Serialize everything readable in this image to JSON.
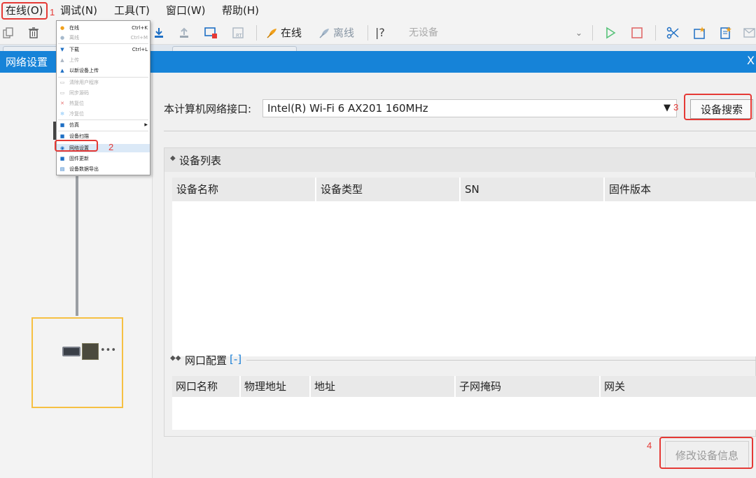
{
  "menubar": {
    "items": [
      "在线(O)",
      "调试(N)",
      "工具(T)",
      "窗口(W)",
      "帮助(H)"
    ]
  },
  "toolbar": {
    "online_label": "在线",
    "offline_label": "离线",
    "help_label": "|?",
    "device_placeholder": "无设备",
    "icons": [
      "copy-icon",
      "delete-icon",
      "download-icon",
      "upload-icon",
      "monitor-icon",
      "rt-icon",
      "online-icon",
      "offline-icon",
      "help-icon",
      "run-icon",
      "stop-icon",
      "cut-icon",
      "new-icon",
      "doc-icon",
      "mail-icon"
    ]
  },
  "dropdown": {
    "items": [
      {
        "label": "在线",
        "shortcut": "Ctrl+K",
        "icon": "online-icon",
        "disabled": false
      },
      {
        "label": "离线",
        "shortcut": "Ctrl+M",
        "icon": "offline-icon",
        "disabled": true
      },
      {
        "label": "下载",
        "shortcut": "Ctrl+L",
        "icon": "download-icon",
        "disabled": false
      },
      {
        "label": "上传",
        "shortcut": "",
        "icon": "upload-icon",
        "disabled": true
      },
      {
        "label": "以新设备上传",
        "shortcut": "",
        "icon": "upload-new-icon",
        "disabled": false
      },
      {
        "label": "清除用户程序",
        "shortcut": "",
        "icon": "clear-icon",
        "disabled": true
      },
      {
        "label": "同步源码",
        "shortcut": "",
        "icon": "sync-icon",
        "disabled": true
      },
      {
        "label": "热复位",
        "shortcut": "",
        "icon": "warm-reset-icon",
        "disabled": true
      },
      {
        "label": "冷复位",
        "shortcut": "",
        "icon": "cold-reset-icon",
        "disabled": true
      },
      {
        "label": "仿真",
        "shortcut": "",
        "icon": "simulate-icon",
        "disabled": false,
        "submenu": true
      },
      {
        "label": "设备扫描",
        "shortcut": "",
        "icon": "scan-icon",
        "disabled": false
      },
      {
        "label": "网络设置",
        "shortcut": "",
        "icon": "network-icon",
        "disabled": false
      },
      {
        "label": "固件更新",
        "shortcut": "",
        "icon": "firmware-icon",
        "disabled": false
      },
      {
        "label": "设备数据导出",
        "shortcut": "",
        "icon": "export-icon",
        "disabled": false
      }
    ]
  },
  "dialog": {
    "title": "网络设置",
    "close": "X",
    "nic_label": "本计算机网络接口:",
    "nic_value": "Intel(R) Wi-Fi 6 AX201 160MHz",
    "search_button": "设备搜索",
    "device_list_label": "设备列表",
    "device_columns": [
      "设备名称",
      "设备类型",
      "SN",
      "固件版本"
    ],
    "port_config_label": "网口配置",
    "port_config_toggle": "[-]",
    "port_columns": [
      "网口名称",
      "物理地址",
      "地址",
      "子网掩码",
      "网关"
    ],
    "modify_button": "修改设备信息"
  },
  "annotations": [
    "1",
    "2",
    "3",
    "4"
  ],
  "colors": {
    "title_bar": "#1683d8",
    "annotation_red": "#e53935",
    "node_border": "#f6c042",
    "link_blue": "#1a7fd6"
  }
}
